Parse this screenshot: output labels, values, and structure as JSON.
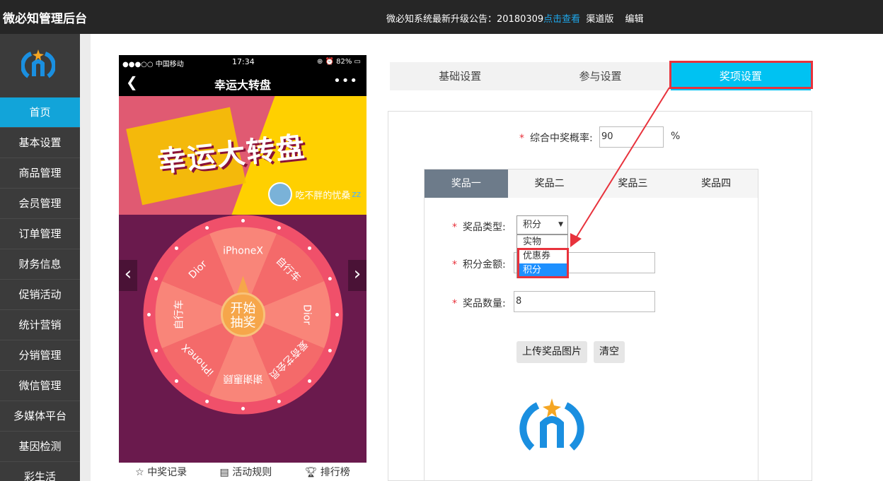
{
  "header": {
    "brand": "微必知管理后台",
    "notice_text": "微必知系统最新升级公告：20180309",
    "notice_link": "点击查看",
    "channel": "渠道版",
    "edit": "编辑"
  },
  "sidebar": {
    "items": [
      {
        "label": "首页"
      },
      {
        "label": "基本设置"
      },
      {
        "label": "商品管理"
      },
      {
        "label": "会员管理"
      },
      {
        "label": "订单管理"
      },
      {
        "label": "财务信息"
      },
      {
        "label": "促销活动"
      },
      {
        "label": "统计营销"
      },
      {
        "label": "分销管理"
      },
      {
        "label": "微信管理"
      },
      {
        "label": "多媒体平台"
      },
      {
        "label": "基因检测"
      },
      {
        "label": "彩生活"
      }
    ]
  },
  "phone": {
    "carrier": "●●●○○ 中国移动",
    "time": "17:34",
    "battery": "82%",
    "title": "幸运大转盘",
    "banner_title": "幸运大转盘",
    "username": "吃不胖的忧桑",
    "wheel_center": [
      "开始",
      "抽奖"
    ],
    "wheel_segments": [
      "iPhoneX",
      "自行车",
      "Dior",
      "爱奇艺会员",
      "谢谢惠顾",
      "iPhoneX",
      "自行车",
      "Dior"
    ],
    "bottom_links": [
      "中奖记录",
      "活动规则",
      "排行榜"
    ]
  },
  "settings": {
    "tabs": [
      "基础设置",
      "参与设置",
      "奖项设置"
    ],
    "active_tab": "奖项设置",
    "overall_rate_label": "综合中奖概率:",
    "overall_rate_value": "90",
    "overall_rate_unit": "%",
    "prize_tabs": [
      "奖品一",
      "奖品二",
      "奖品三",
      "奖品四"
    ],
    "prize_type_label": "奖品类型:",
    "prize_type_value": "积分",
    "prize_type_options": [
      "实物",
      "优惠券",
      "积分"
    ],
    "points_label": "积分金额:",
    "points_value": "",
    "quantity_label": "奖品数量:",
    "quantity_value": "8",
    "upload_button": "上传奖品图片",
    "clear_button": "清空"
  },
  "colors": {
    "topbar": "#262626",
    "sidebar": "#3b3b3b",
    "active_menu": "#12a4d9",
    "active_tab": "#00c2f2",
    "highlight": "#e8323c"
  }
}
